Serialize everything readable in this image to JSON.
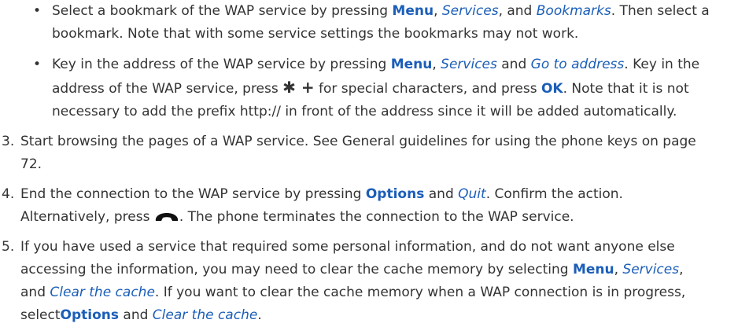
{
  "bullets": [
    {
      "marker": "•",
      "lines": [
        [
          "Select a bookmark of the WAP service by pressing ",
          {
            "k": "Menu"
          },
          ", ",
          {
            "i": "Services"
          },
          ", and ",
          {
            "i": "Bookmarks"
          },
          ". Then select a"
        ],
        [
          "bookmark. Note that with some service settings the bookmarks may not work."
        ]
      ]
    },
    {
      "marker": "•",
      "lines": [
        [
          "Key in the address of the WAP service by pressing ",
          {
            "k": "Menu"
          },
          ", ",
          {
            "i": "Services"
          },
          " and ",
          {
            "i": "Go to address"
          },
          ". Key in the"
        ],
        [
          "address of the WAP service, press ",
          {
            "s": "✱ +"
          },
          " for special characters, and press ",
          {
            "k": "OK"
          },
          ". Note that it is not"
        ],
        [
          "necessary to add the prefix http:// in front of the address since it will be added automatically."
        ]
      ]
    }
  ],
  "steps": [
    {
      "number": "3.",
      "lines": [
        [
          "Start browsing the pages of a WAP service. See General guidelines for using the phone keys on page"
        ],
        [
          "72."
        ]
      ]
    },
    {
      "number": "4.",
      "lines": [
        [
          "End the connection to the WAP service by pressing ",
          {
            "k": "Options"
          },
          " and ",
          {
            "i": "Quit"
          },
          ". Confirm the action."
        ],
        [
          "Alternatively, press ",
          {
            "icon": "end-call-key-icon"
          },
          ". The phone terminates the connection to the WAP service."
        ]
      ]
    },
    {
      "number": "5.",
      "lines": [
        [
          "If you have used a service that required some personal information, and do not want anyone else"
        ],
        [
          "accessing the information, you may need to clear the cache memory by selecting ",
          {
            "k": "Menu"
          },
          ", ",
          {
            "i": "Services"
          },
          ","
        ],
        [
          "and ",
          {
            "i": "Clear the cache"
          },
          ". If you want to clear the cache memory when a WAP connection is in progress,"
        ],
        [
          "select",
          {
            "k": "Options"
          },
          " and ",
          {
            "i": "Clear the cache"
          },
          "."
        ]
      ]
    }
  ],
  "colors": {
    "text": "#333333",
    "emphasis": "#1b5eb8"
  }
}
